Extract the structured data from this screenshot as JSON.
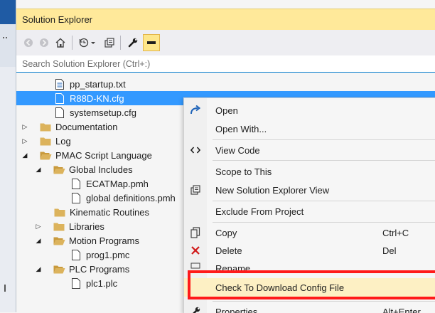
{
  "panel": {
    "title": "Solution Explorer"
  },
  "search": {
    "placeholder": "Search Solution Explorer (Ctrl+:)"
  },
  "toolbar": {
    "buttons": [
      {
        "name": "back-icon"
      },
      {
        "name": "forward-icon"
      },
      {
        "name": "home-icon"
      },
      {
        "name": "history-icon"
      },
      {
        "name": "new-view-icon"
      },
      {
        "name": "properties-icon"
      },
      {
        "name": "preview-icon"
      }
    ]
  },
  "tree": {
    "items": [
      {
        "label": "pp_startup.txt"
      },
      {
        "label": "R88D-KN.cfg"
      },
      {
        "label": "systemsetup.cfg"
      },
      {
        "label": "Documentation"
      },
      {
        "label": "Log"
      },
      {
        "label": "PMAC Script Language"
      },
      {
        "label": "Global Includes"
      },
      {
        "label": "ECATMap.pmh"
      },
      {
        "label": "global definitions.pmh"
      },
      {
        "label": "Kinematic Routines"
      },
      {
        "label": "Libraries"
      },
      {
        "label": "Motion Programs"
      },
      {
        "label": "prog1.pmc"
      },
      {
        "label": "PLC Programs"
      },
      {
        "label": "plc1.plc"
      }
    ]
  },
  "context_menu": {
    "items": [
      {
        "label": "Open",
        "shortcut": ""
      },
      {
        "label": "Open With...",
        "shortcut": ""
      },
      {
        "label": "View Code",
        "shortcut": ""
      },
      {
        "label": "Scope to This",
        "shortcut": ""
      },
      {
        "label": "New Solution Explorer View",
        "shortcut": ""
      },
      {
        "label": "Exclude From Project",
        "shortcut": ""
      },
      {
        "label": "Copy",
        "shortcut": "Ctrl+C"
      },
      {
        "label": "Delete",
        "shortcut": "Del"
      },
      {
        "label": "Rename",
        "shortcut": ""
      },
      {
        "label": "Check To Download Config File",
        "shortcut": ""
      },
      {
        "label": "Properties",
        "shortcut": "Alt+Enter"
      }
    ]
  },
  "colors": {
    "title_bg": "#ffe99a",
    "selection": "#3399ff",
    "highlight_box": "#ff1a1a",
    "folder": "#dcb35c"
  }
}
